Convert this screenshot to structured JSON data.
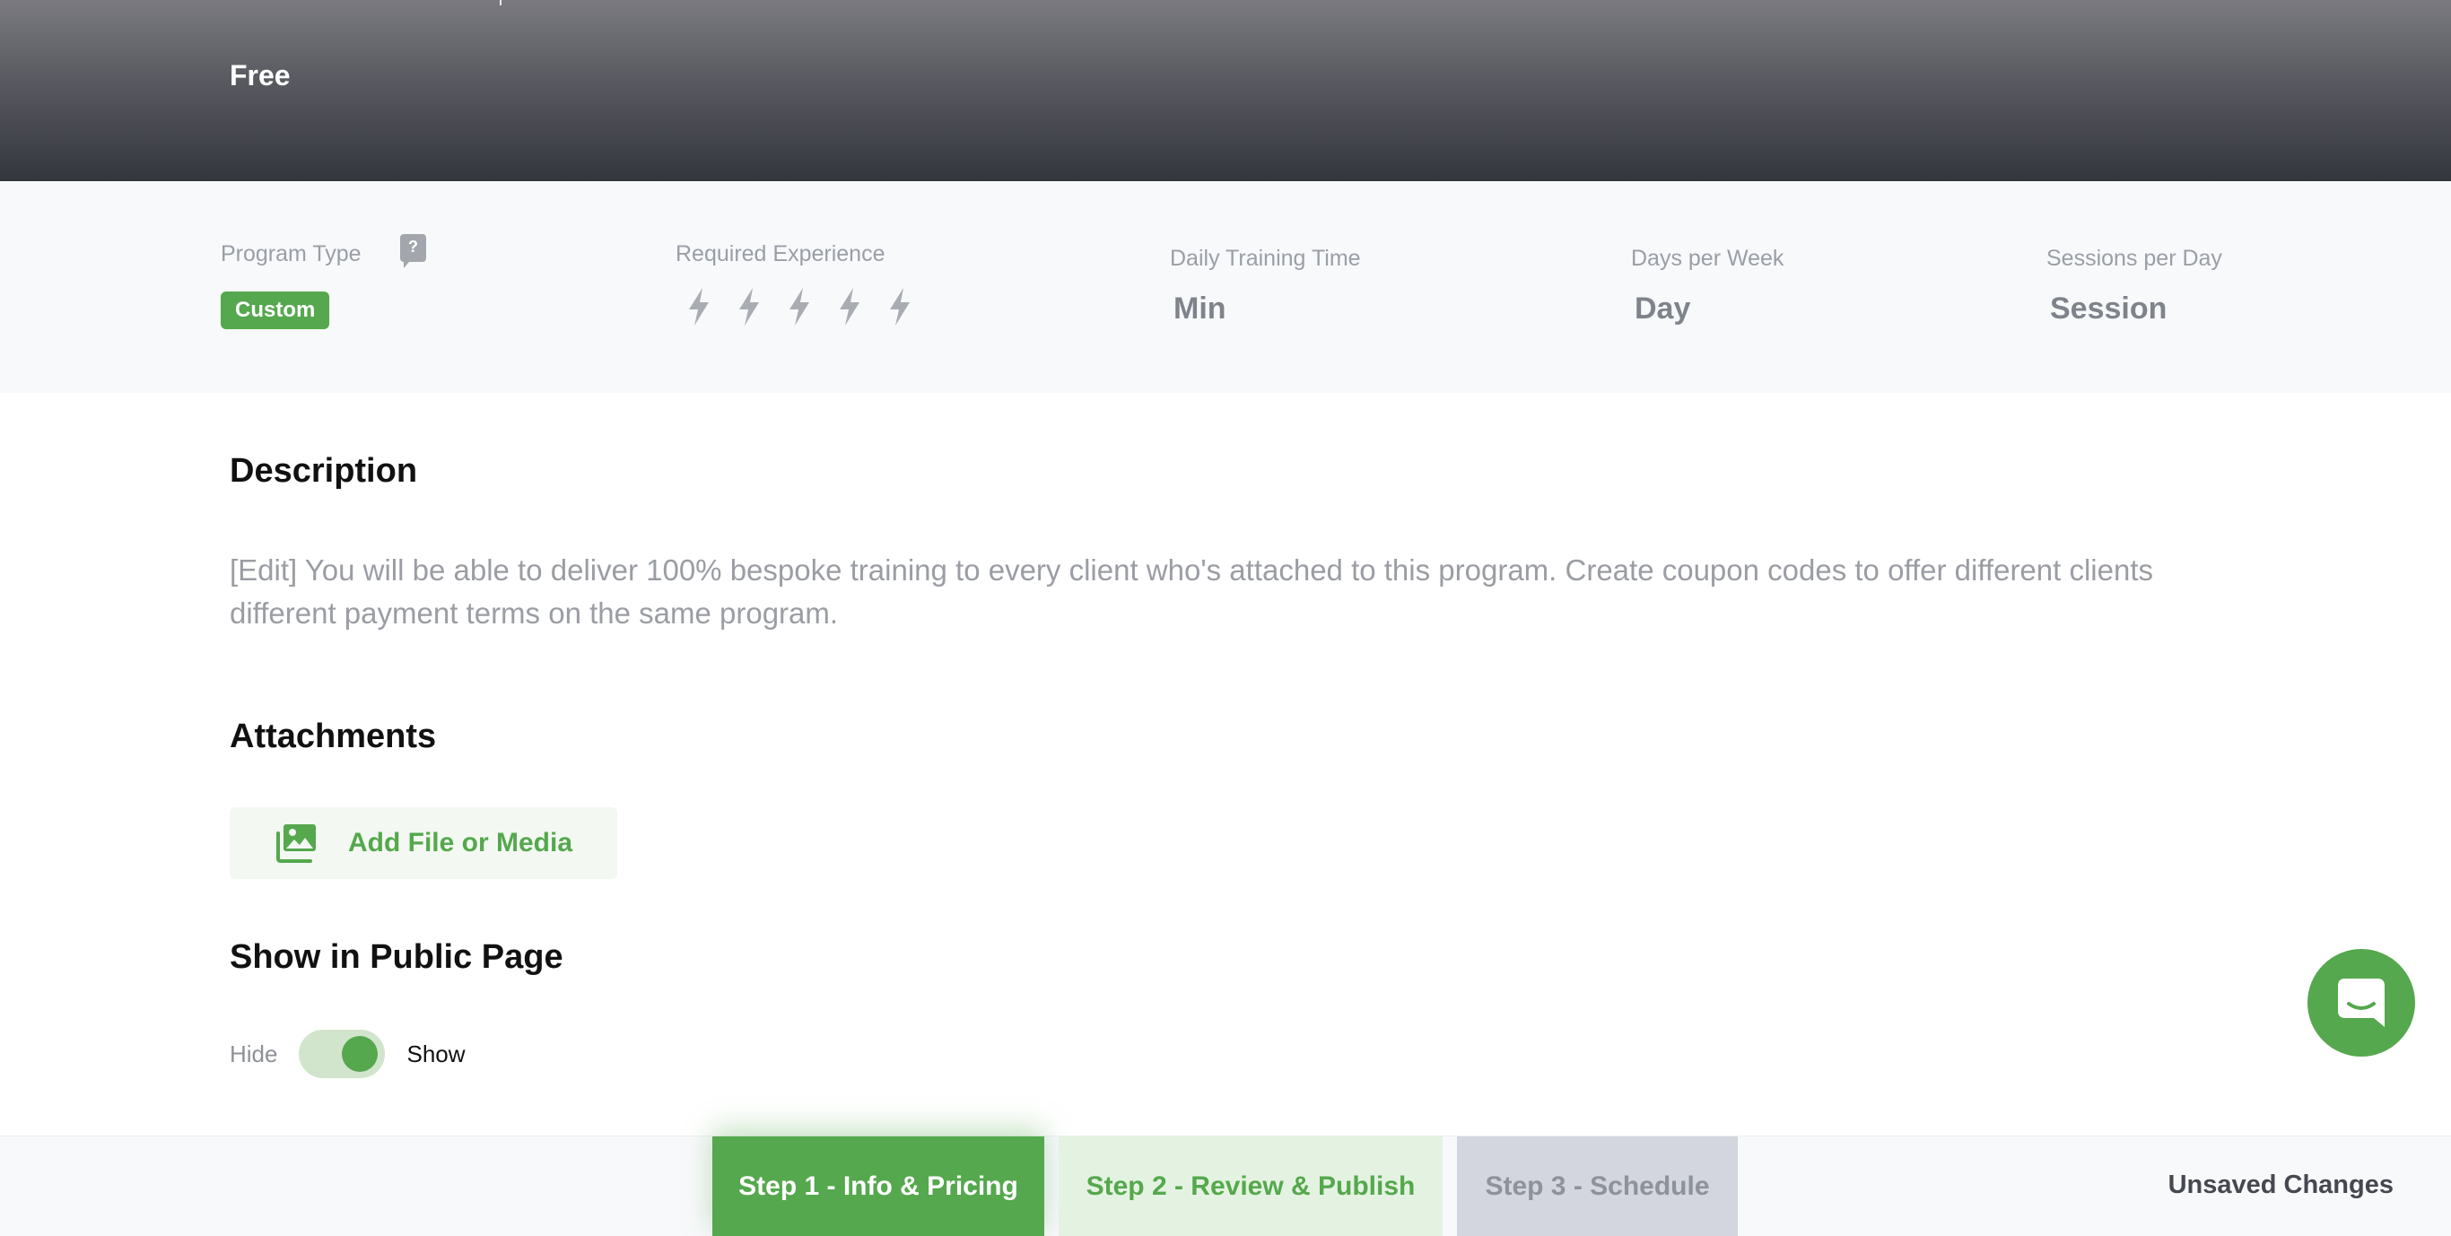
{
  "header": {
    "price": "Free"
  },
  "stats": {
    "program_type": {
      "label": "Program Type",
      "help_icon": "question-icon",
      "value": "Custom"
    },
    "required_experience": {
      "label": "Required Experience",
      "level": 0,
      "max": 5,
      "icon": "lightning-bolt-icon"
    },
    "daily_training_time": {
      "label": "Daily Training Time",
      "value": "Min"
    },
    "days_per_week": {
      "label": "Days per Week",
      "value": "Day"
    },
    "sessions_per_day": {
      "label": "Sessions per Day",
      "value": "Session"
    }
  },
  "description": {
    "title": "Description",
    "text": "[Edit] You will be able to deliver 100% bespoke training to every client who's attached to this program. Create coupon codes to offer different clients different payment terms on the same program."
  },
  "attachments": {
    "title": "Attachments",
    "add_label": "Add File or Media",
    "add_icon": "image-stack-icon"
  },
  "public_page": {
    "title": "Show in Public Page",
    "off_label": "Hide",
    "on_label": "Show",
    "enabled": true
  },
  "chat": {
    "icon": "chat-bubble-icon"
  },
  "footer": {
    "steps": [
      {
        "label": "Step 1 - Info & Pricing",
        "state": "active"
      },
      {
        "label": "Step 2 - Review & Publish",
        "state": "available"
      },
      {
        "label": "Step 3 - Schedule",
        "state": "disabled"
      }
    ],
    "status": "Unsaved Changes"
  },
  "colors": {
    "accent": "#55a84d",
    "accent_light": "#e4f3e1",
    "muted_text": "#9a9da3"
  }
}
